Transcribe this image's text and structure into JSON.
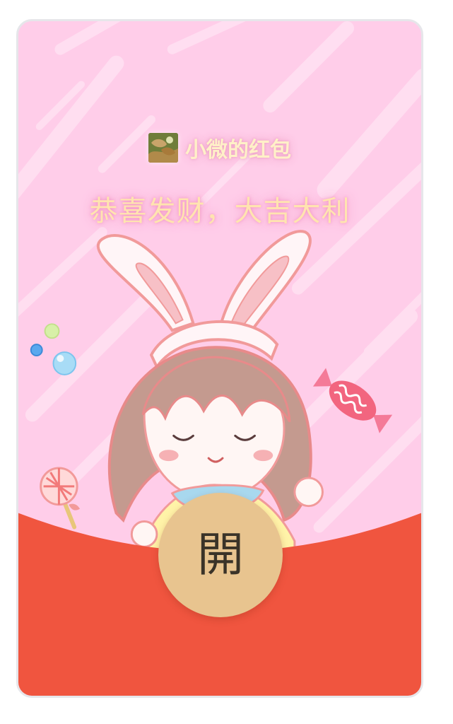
{
  "red_packet": {
    "sender_name": "小微的红包",
    "greeting": "恭喜发财，大吉大利",
    "open_label": "開"
  },
  "colors": {
    "background_pink": "#ffcde9",
    "envelope_red": "#f0553f",
    "open_button_gold": "#e8c48f",
    "greeting_gold": "#ffe4b0"
  },
  "icons": {
    "avatar": "sender-avatar",
    "illustration": "bunny-ear-girl-illustration",
    "candy": "wrapped-candy-icon",
    "lollipop": "lollipop-icon",
    "bubbles": "bubbles-icon"
  }
}
